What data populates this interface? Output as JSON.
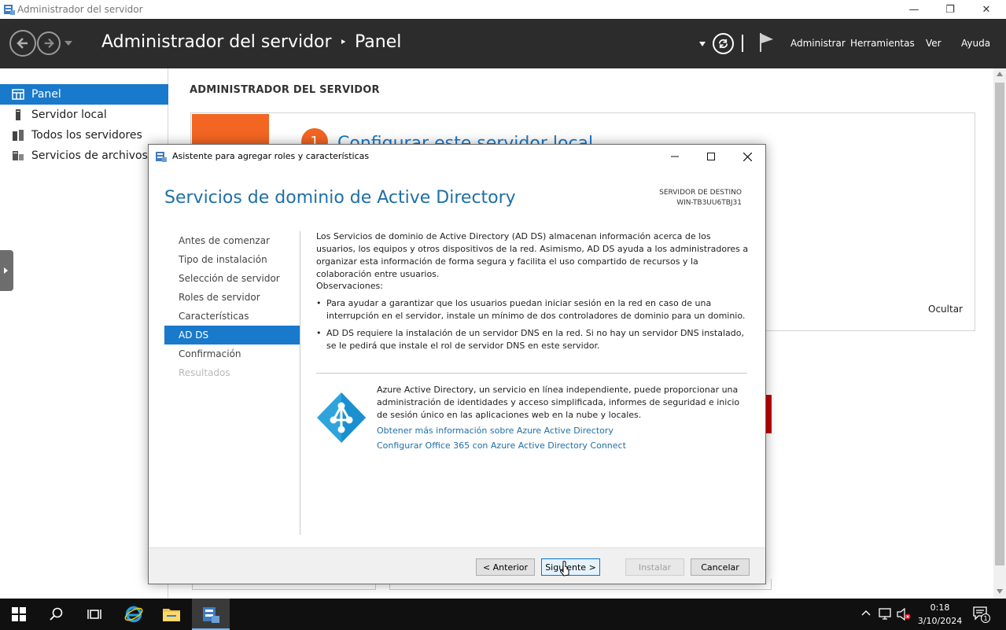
{
  "window": {
    "title": "Administrador del servidor",
    "minimize": "—",
    "restore": "❐",
    "close": "✕"
  },
  "header": {
    "breadcrumb_root": "Administrador del servidor",
    "separator": "‣",
    "breadcrumb_page": "Panel",
    "menus": [
      "Administrar",
      "Herramientas",
      "Ver",
      "Ayuda"
    ]
  },
  "sidebar": {
    "items": [
      {
        "label": "Panel",
        "icon": "dashboard-icon",
        "selected": true
      },
      {
        "label": "Servidor local",
        "icon": "server-icon",
        "selected": false
      },
      {
        "label": "Todos los servidores",
        "icon": "servers-icon",
        "selected": false
      },
      {
        "label": "Servicios de archivos y...",
        "icon": "file-services-icon",
        "selected": false
      }
    ]
  },
  "main": {
    "title": "ADMINISTRADOR DEL SERVIDOR",
    "step_number": "1",
    "step_title": "Configurar este servidor local",
    "hide_label": "Ocultar"
  },
  "dialog": {
    "title": "Asistente para agregar roles y características",
    "heading": "Servicios de dominio de Active Directory",
    "dest_label": "SERVIDOR DE DESTINO",
    "dest_server": "WIN-TB3UU6TBJ31",
    "nav": [
      {
        "label": "Antes de comenzar",
        "state": "normal"
      },
      {
        "label": "Tipo de instalación",
        "state": "normal"
      },
      {
        "label": "Selección de servidor",
        "state": "normal"
      },
      {
        "label": "Roles de servidor",
        "state": "normal"
      },
      {
        "label": "Características",
        "state": "normal"
      },
      {
        "label": "AD DS",
        "state": "selected"
      },
      {
        "label": "Confirmación",
        "state": "normal"
      },
      {
        "label": "Resultados",
        "state": "disabled"
      }
    ],
    "intro": "Los Servicios de dominio de Active Directory (AD DS) almacenan información acerca de los usuarios, los equipos y otros dispositivos de la red. Asimismo, AD DS ayuda a los administradores a organizar esta información de forma segura y facilita el uso compartido de recursos y la colaboración entre usuarios.",
    "observations_label": "Observaciones:",
    "bullets": [
      "Para ayudar a garantizar que los usuarios puedan iniciar sesión en la red en caso de una interrupción en el servidor, instale un mínimo de dos controladores de dominio para un dominio.",
      "AD DS requiere la instalación de un servidor DNS en la red. Si no hay un servidor DNS instalado, se le pedirá que instale el rol de servidor DNS en este servidor."
    ],
    "azure_text": "Azure Active Directory, un servicio en línea independiente, puede proporcionar una administración de identidades y acceso simplificada, informes de seguridad e inicio de sesión único en las aplicaciones web en la nube y locales.",
    "links": [
      "Obtener más información sobre Azure Active Directory",
      "Configurar Office 365 con Azure Active Directory Connect"
    ],
    "buttons": {
      "previous": "< Anterior",
      "next": "Siguiente >",
      "install": "Instalar",
      "cancel": "Cancelar"
    }
  },
  "taskbar": {
    "time": "0:18",
    "date": "3/10/2024",
    "notification_count": "1"
  },
  "colors": {
    "accent": "#1979ca",
    "header_bg": "#2c2c2c",
    "orange": "#f26522",
    "link": "#1e6fa6"
  }
}
